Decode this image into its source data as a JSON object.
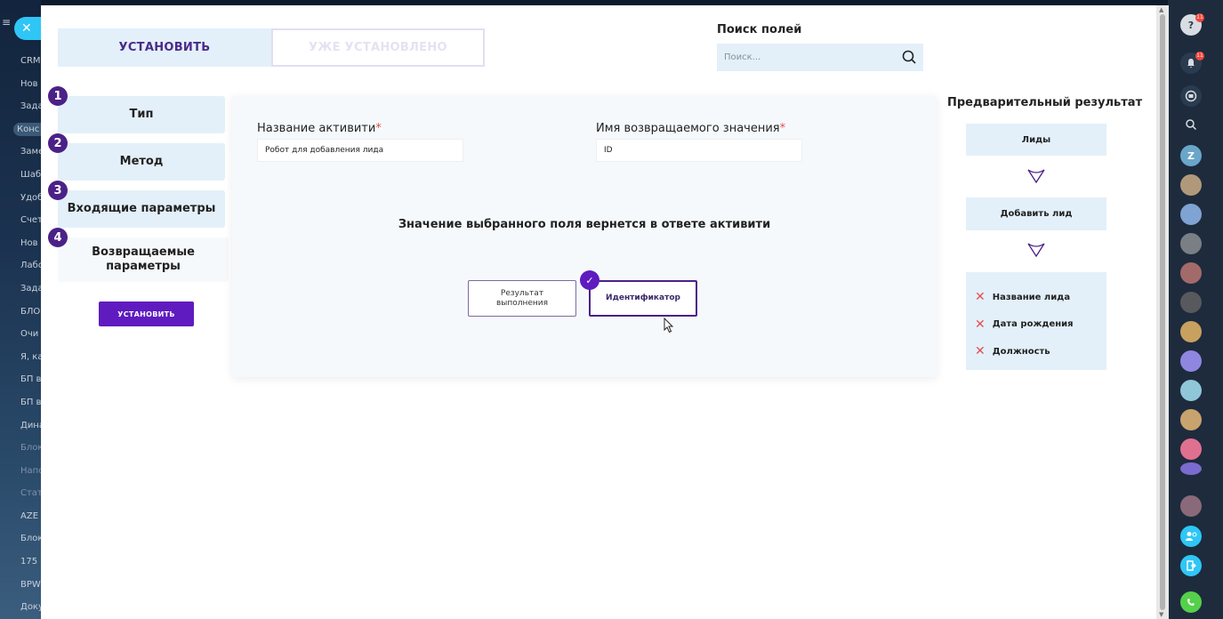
{
  "sidebar": {
    "items": [
      "CRM",
      "Нов",
      "Зада",
      "Конс",
      "Заме",
      "Шаб",
      "Удоб",
      "Счет",
      "Нов",
      "Лабо",
      "Зада",
      "БЛО",
      "Очи",
      "Я, ка",
      "БП в",
      "БП в",
      "Дина",
      "Блок",
      "Напо",
      "Стат",
      "AZE",
      "Блок",
      "175 ч",
      "BPW",
      "Доку"
    ]
  },
  "tabs": {
    "install": "УСТАНОВИТЬ",
    "installed": "УЖЕ УСТАНОВЛЕНО"
  },
  "search": {
    "label": "Поиск полей",
    "placeholder": "Поиск..."
  },
  "steps": [
    {
      "num": "1",
      "label": "Тип"
    },
    {
      "num": "2",
      "label": "Метод"
    },
    {
      "num": "3",
      "label": "Входящие параметры"
    },
    {
      "num": "4",
      "label": "Возвращаемые параметры"
    }
  ],
  "install_button": "УСТАНОВИТЬ",
  "form": {
    "activity_name_label": "Название активити",
    "activity_name_value": "Робот для добавления лида",
    "return_name_label": "Имя возвращаемого значения",
    "return_name_value": "ID",
    "required_mark": "*",
    "heading": "Значение выбранного поля вернется в ответе активити",
    "option_result": "Результат выполнения",
    "option_id": "Идентификатор"
  },
  "preview": {
    "title": "Предварительный результат",
    "box1": "Лиды",
    "box2": "Добавить лид",
    "fields": [
      "Название лида",
      "Дата рождения",
      "Должность"
    ]
  },
  "right_panel": {
    "badge_help": "11",
    "badge_notif": "11",
    "avatar_letter": "Z"
  },
  "colors": {
    "accent": "#5f1bbf",
    "accent_dark": "#4b2188",
    "light_blue": "#e3f0f9",
    "cross": "#e05050"
  }
}
